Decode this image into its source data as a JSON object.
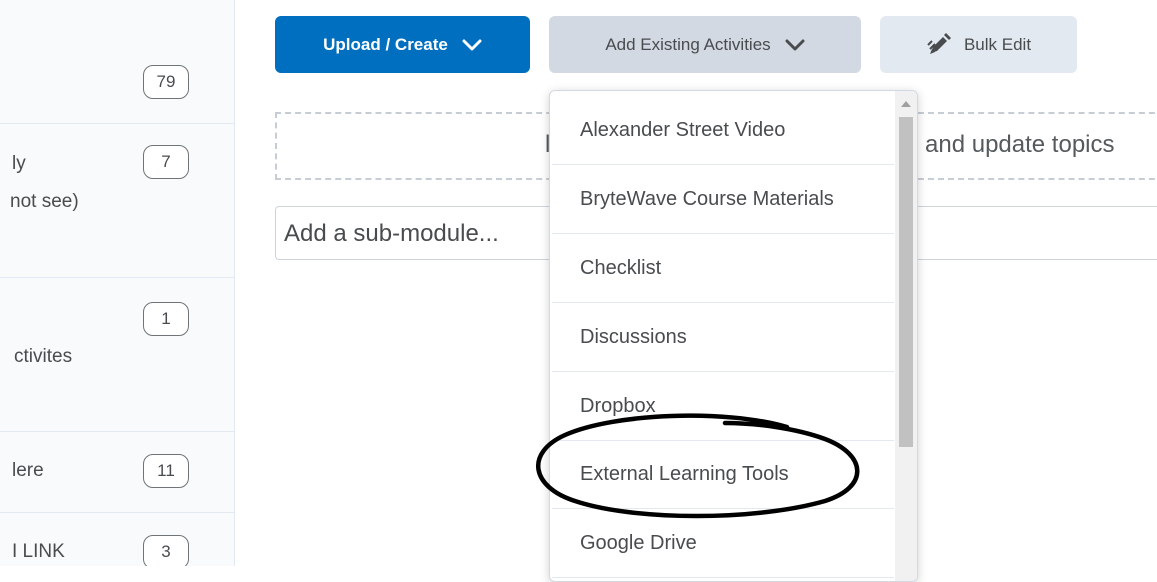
{
  "sidebar": {
    "items": [
      {
        "label": "",
        "sublabel": "",
        "count": "79"
      },
      {
        "label": "ly",
        "sublabel": "not see)",
        "count": "7"
      },
      {
        "label": "",
        "sublabel": "ctivites",
        "count": "1"
      },
      {
        "label": "lere",
        "sublabel": "",
        "count": "11"
      },
      {
        "label": "I LINK",
        "sublabel": "",
        "count": "3"
      }
    ]
  },
  "toolbar": {
    "upload_label": "Upload / Create",
    "add_existing_label": "Add Existing Activities",
    "bulk_edit_label": "Bulk Edit"
  },
  "dropzone": {
    "text_left": "l",
    "text_right": "e and update topics"
  },
  "submodule": {
    "placeholder": "Add a sub-module..."
  },
  "menu": {
    "items": [
      "Alexander Street Video",
      "BryteWave Course Materials",
      "Checklist",
      "Discussions",
      "Dropbox",
      "External Learning Tools",
      "Google Drive"
    ]
  },
  "colors": {
    "primary": "#006fbf",
    "secondary": "#d3d9e3",
    "light": "#e3e9f1",
    "annotation": "#000000"
  },
  "icons": {
    "bulk_edit": "pencil-edit-icon",
    "dropdown": "chevron-down-icon"
  }
}
